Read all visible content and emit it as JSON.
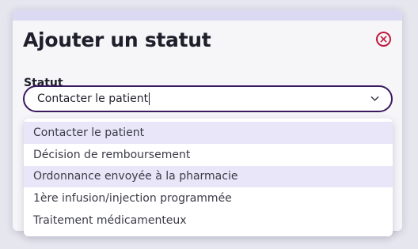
{
  "modal": {
    "title": "Ajouter un statut",
    "close_icon": "close-circle-icon",
    "close_color": "#c2183a"
  },
  "field": {
    "label": "Statut",
    "value": "Contacter le patient",
    "chevron_icon": "chevron-down-icon"
  },
  "dropdown": {
    "options": [
      {
        "label": "Contacter le patient",
        "highlighted": true
      },
      {
        "label": "Décision de remboursement",
        "highlighted": false
      },
      {
        "label": "Ordonnance envoyée à la pharmacie",
        "highlighted": true
      },
      {
        "label": "1ère infusion/injection programmée",
        "highlighted": false
      },
      {
        "label": "Traitement médicamenteux",
        "highlighted": false
      }
    ]
  },
  "colors": {
    "accent": "#3a1a5e",
    "highlight": "#e8e6f8",
    "danger": "#c2183a"
  }
}
